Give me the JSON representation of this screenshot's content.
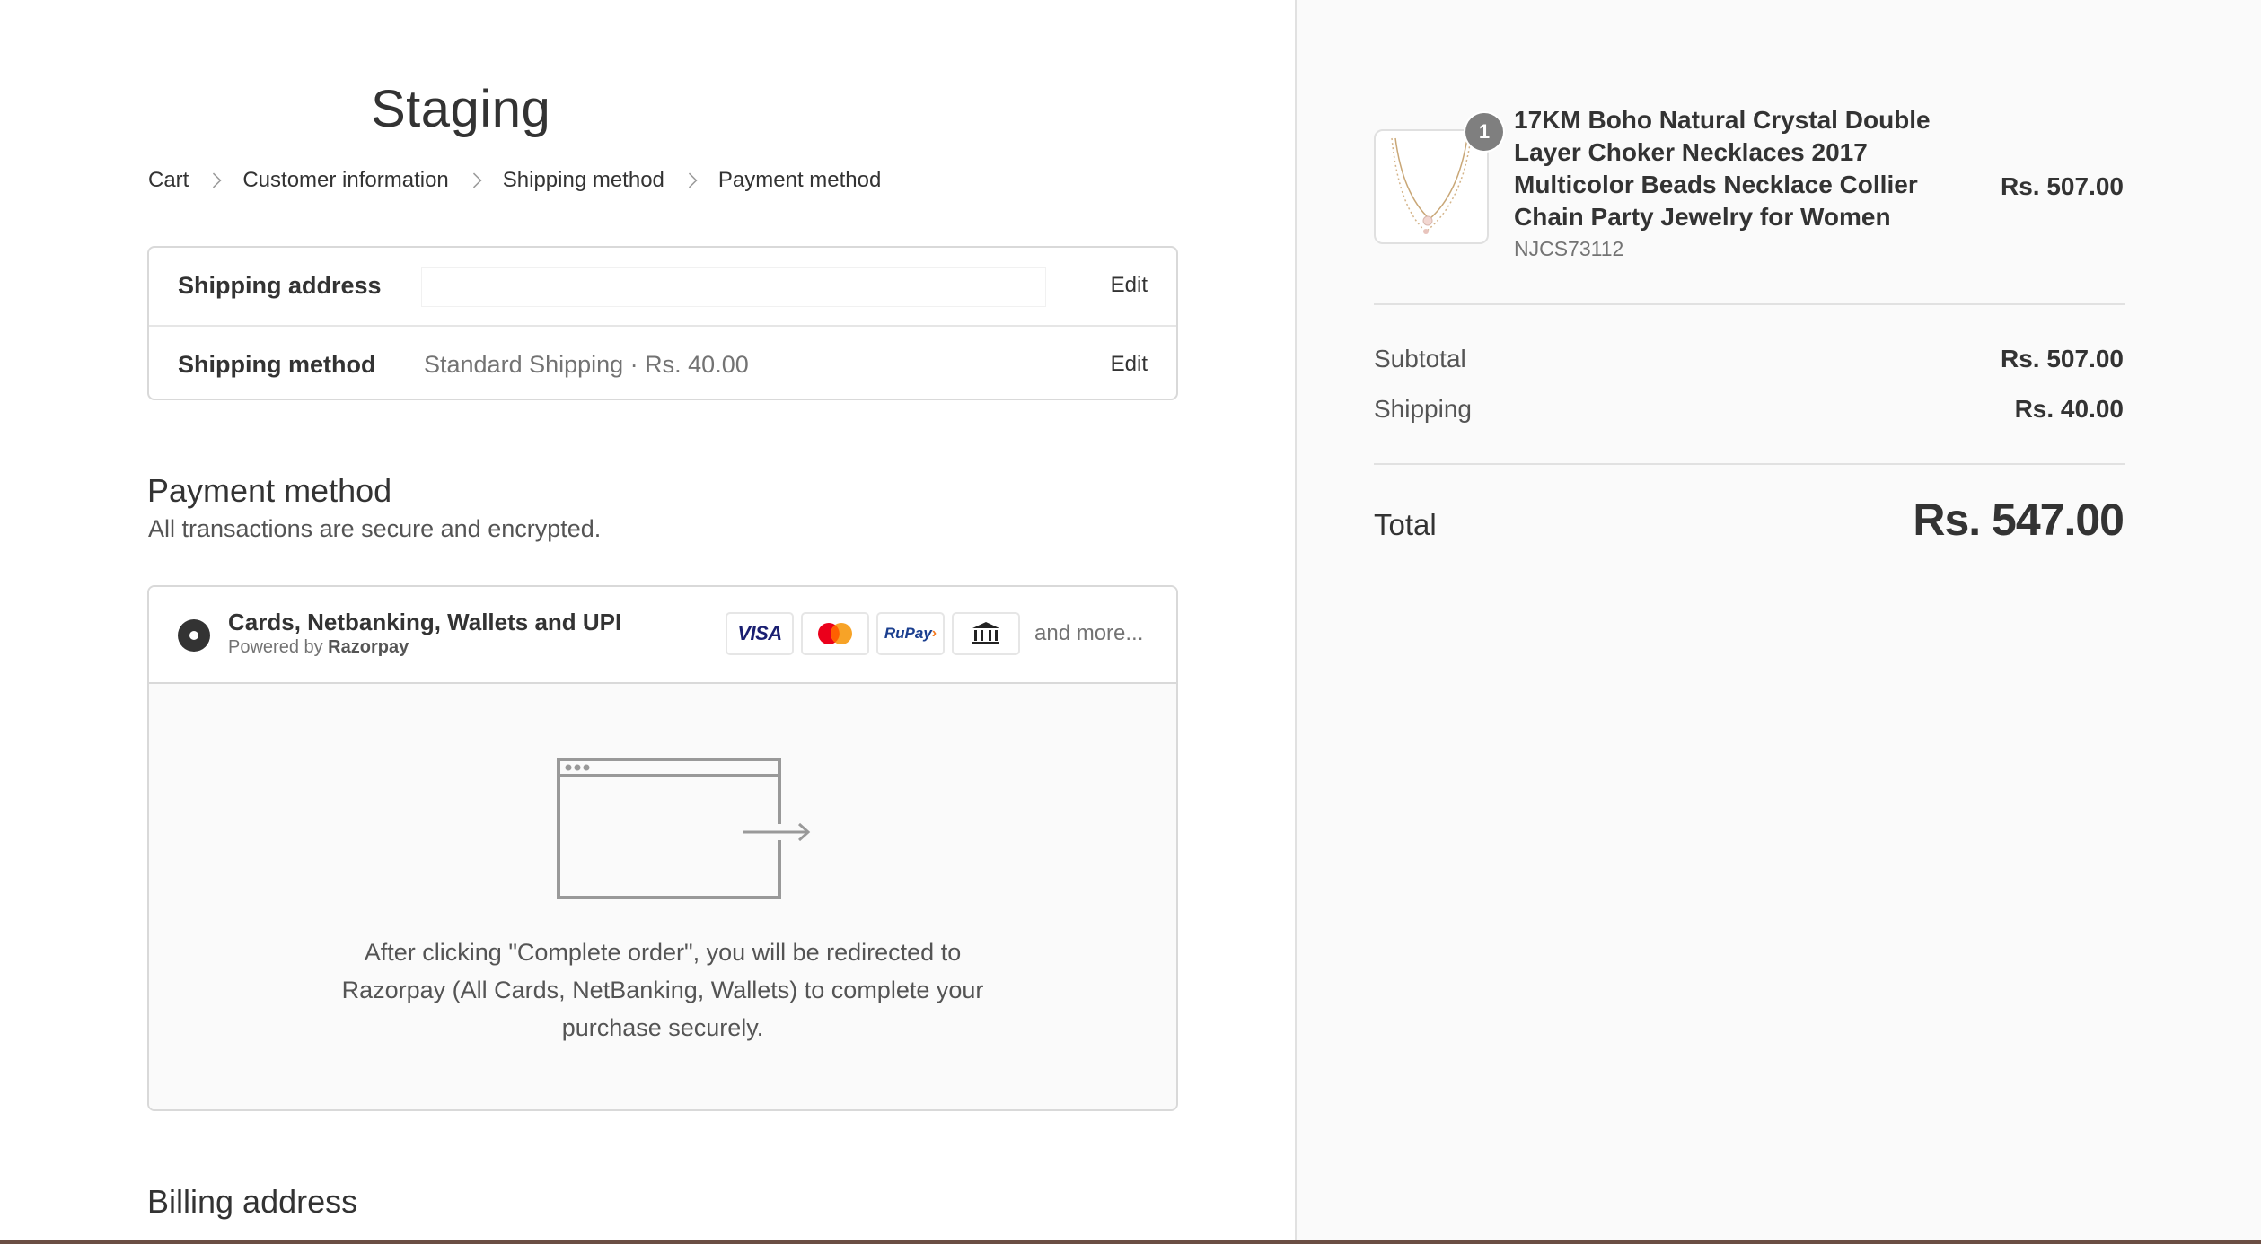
{
  "store": {
    "title": "Staging"
  },
  "breadcrumb": {
    "items": [
      "Cart",
      "Customer information",
      "Shipping method",
      "Payment method"
    ]
  },
  "review": {
    "shipping_address_label": "Shipping address",
    "shipping_address_value": "",
    "shipping_method_label": "Shipping method",
    "shipping_method_value": "Standard Shipping · Rs. 40.00",
    "edit_label": "Edit"
  },
  "payment": {
    "title": "Payment method",
    "subtitle": "All transactions are secure and encrypted.",
    "option_name": "Cards, Netbanking, Wallets and UPI",
    "powered_prefix": "Powered by ",
    "powered_brand": "Razorpay",
    "card_icons": [
      "visa-icon",
      "mastercard-icon",
      "rupay-icon",
      "bank-icon"
    ],
    "visa_text": "VISA",
    "rupay_text": "RuPay",
    "and_more": "and more...",
    "redirect_lines": [
      "After clicking \"Complete order\", you will be redirected to",
      "Razorpay (All Cards, NetBanking, Wallets) to complete your",
      "purchase securely."
    ],
    "selected": true
  },
  "billing": {
    "title": "Billing address"
  },
  "order_summary": {
    "product": {
      "quantity": "1",
      "name_lines": [
        "17KM Boho Natural Crystal Double",
        "Layer Choker Necklaces 2017",
        "Multicolor Beads Necklace Collier",
        "Chain Party Jewelry for Women"
      ],
      "sku": "NJCS73112",
      "price": "Rs. 507.00"
    },
    "subtotal_label": "Subtotal",
    "subtotal_value": "Rs. 507.00",
    "shipping_label": "Shipping",
    "shipping_value": "Rs. 40.00",
    "total_label": "Total",
    "total_value": "Rs. 547.00"
  },
  "colors": {
    "text": "#333333",
    "muted": "#737373",
    "border": "#d9d9d9",
    "sidebar_bg": "#fafafa",
    "badge": "#7f7f7f"
  }
}
